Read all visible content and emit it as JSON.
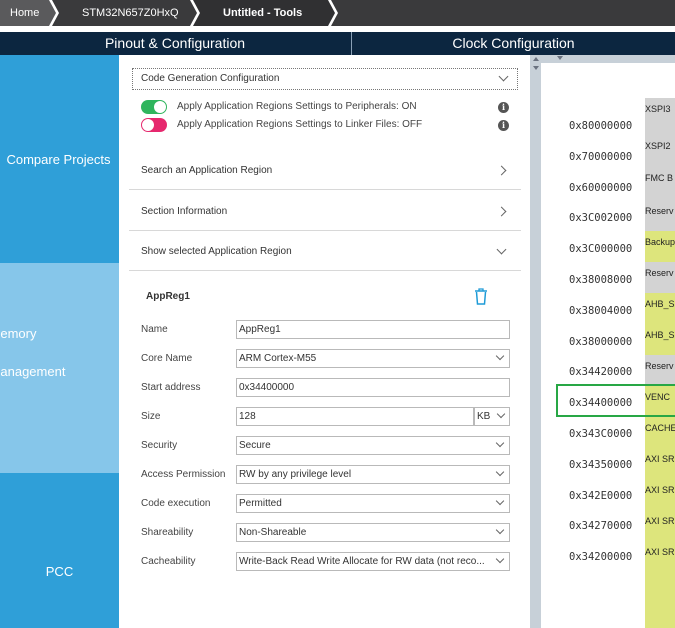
{
  "breadcrumb": {
    "home": "Home",
    "mcu": "STM32N657Z0HxQ",
    "project": "Untitled - Tools"
  },
  "tabs": [
    "Pinout & Configuration",
    "Clock Configuration"
  ],
  "sidebar": {
    "compare": "Compare Projects",
    "memory_line1": "Memory",
    "memory_line2": "Management",
    "pcc": "PCC"
  },
  "panel": {
    "code_gen_config": "Code Generation Configuration",
    "toggle_peripherals": {
      "label": "Apply Application Regions Settings to Peripherals: ON",
      "state": "on",
      "color": "#2fb55d"
    },
    "toggle_linker": {
      "label": "Apply Application Regions Settings to Linker Files: OFF",
      "state": "off",
      "color": "#e6286e"
    },
    "search_region": "Search an Application Region",
    "section_info": "Section Information",
    "show_selected": "Show selected Application Region",
    "region_name": "AppReg1",
    "fields": {
      "name": {
        "label": "Name",
        "value": "AppReg1"
      },
      "core_name": {
        "label": "Core Name",
        "value": "ARM Cortex-M55"
      },
      "start_address": {
        "label": "Start address",
        "value": "0x34400000"
      },
      "size": {
        "label": "Size",
        "value": "128",
        "unit": "KB"
      },
      "security": {
        "label": "Security",
        "value": "Secure"
      },
      "access_permission": {
        "label": "Access Permission",
        "value": "RW by any privilege level"
      },
      "code_execution": {
        "label": "Code execution",
        "value": "Permitted"
      },
      "shareability": {
        "label": "Shareability",
        "value": "Non-Shareable"
      },
      "cacheability": {
        "label": "Cacheability",
        "value": "Write-Back Read Write Allocate for RW data (not reco..."
      }
    }
  },
  "memory_map": {
    "addresses": [
      "0x80000000",
      "0x70000000",
      "0x60000000",
      "0x3C002000",
      "0x3C000000",
      "0x38008000",
      "0x38004000",
      "0x38000000",
      "0x34420000",
      "0x34400000",
      "0x343C0000",
      "0x34350000",
      "0x342E0000",
      "0x34270000",
      "0x34200000"
    ],
    "regions": [
      "XSPI3",
      "XSPI2",
      "FMC B",
      "Reserv",
      "Backup",
      "Reserv",
      "AHB_S",
      "AHB_S",
      "Reserv",
      "VENC",
      "CACHE",
      "AXI SR",
      "AXI SR",
      "AXI SR",
      "AXI SR"
    ],
    "selected_address": "0x34400000",
    "highlight_color": "#28a745"
  }
}
